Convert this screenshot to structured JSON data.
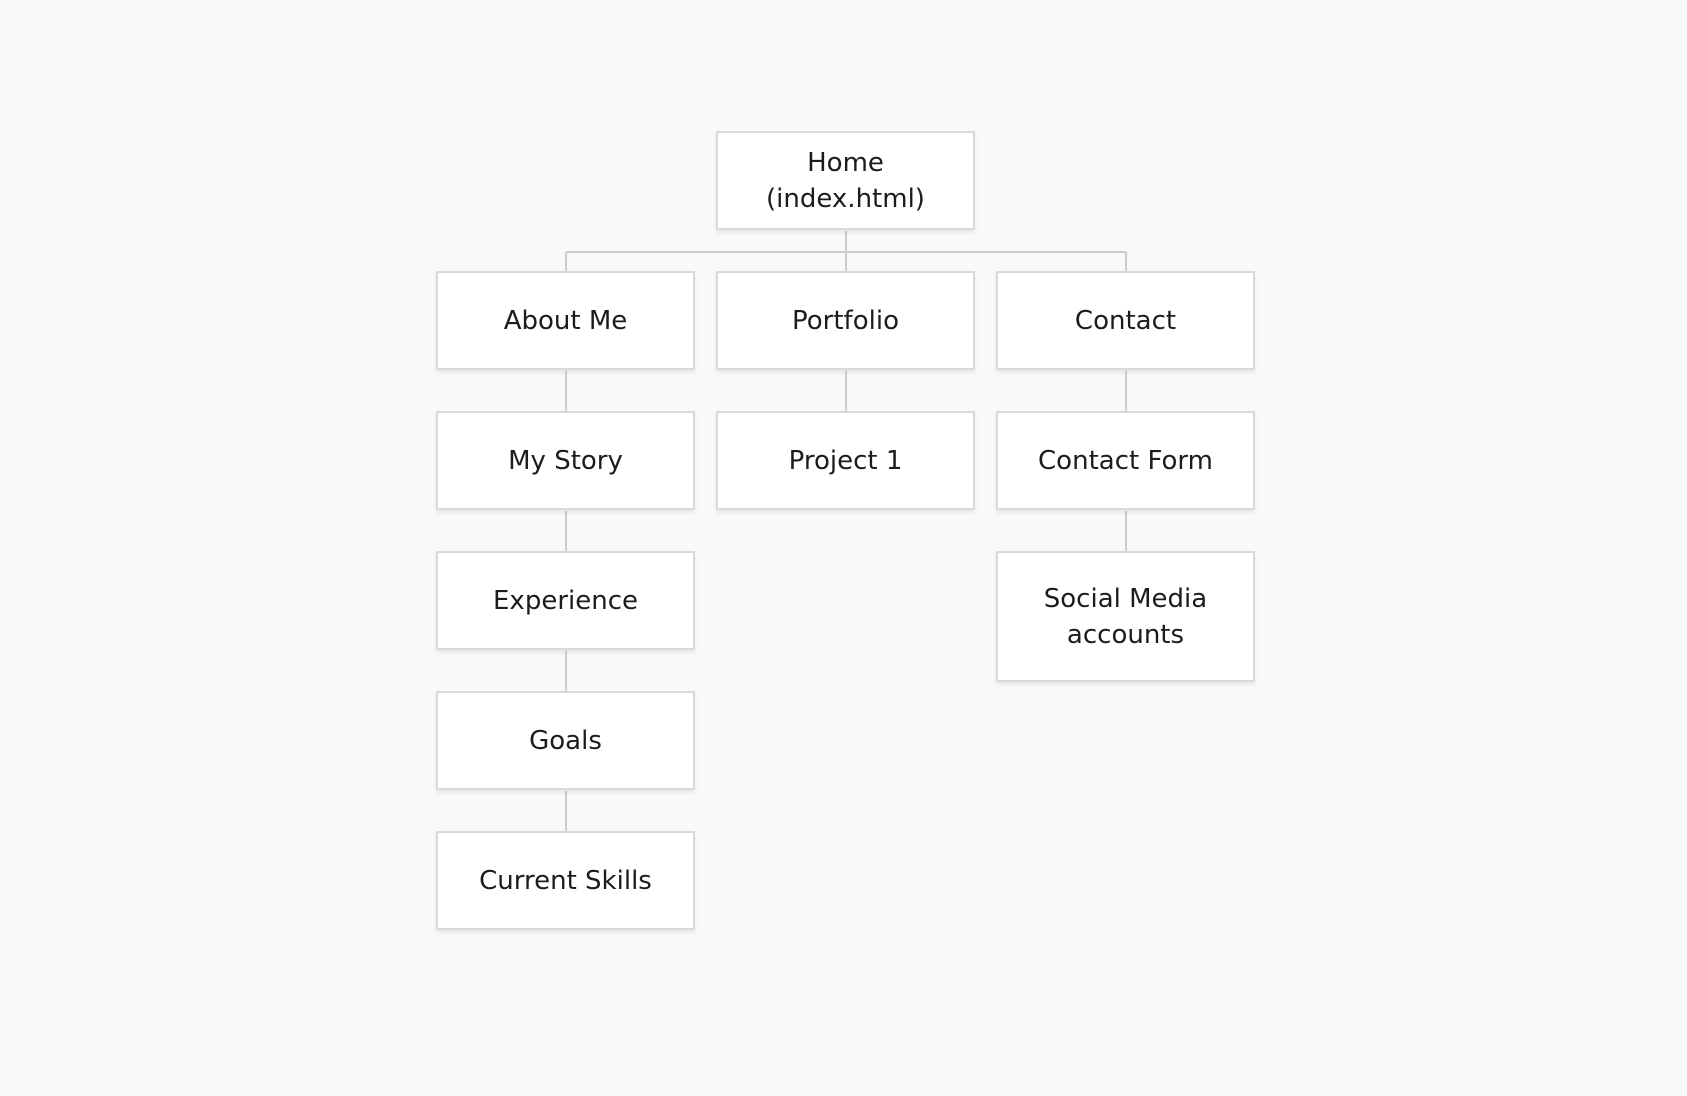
{
  "theme": {
    "background": "#f8f9fa",
    "node_fill": "#ffffff",
    "node_border": "#d9d9d9",
    "connector": "#cccccc",
    "text": "#1c1c1c"
  },
  "sitemap": {
    "root": "Home (index.html)",
    "sections": [
      {
        "label": "About Me",
        "children": [
          "My Story",
          "Experience",
          "Goals",
          "Current Skills"
        ]
      },
      {
        "label": "Portfolio",
        "children": [
          "Project 1"
        ]
      },
      {
        "label": "Contact",
        "children": [
          "Contact Form",
          "Social Media accounts"
        ]
      }
    ]
  }
}
